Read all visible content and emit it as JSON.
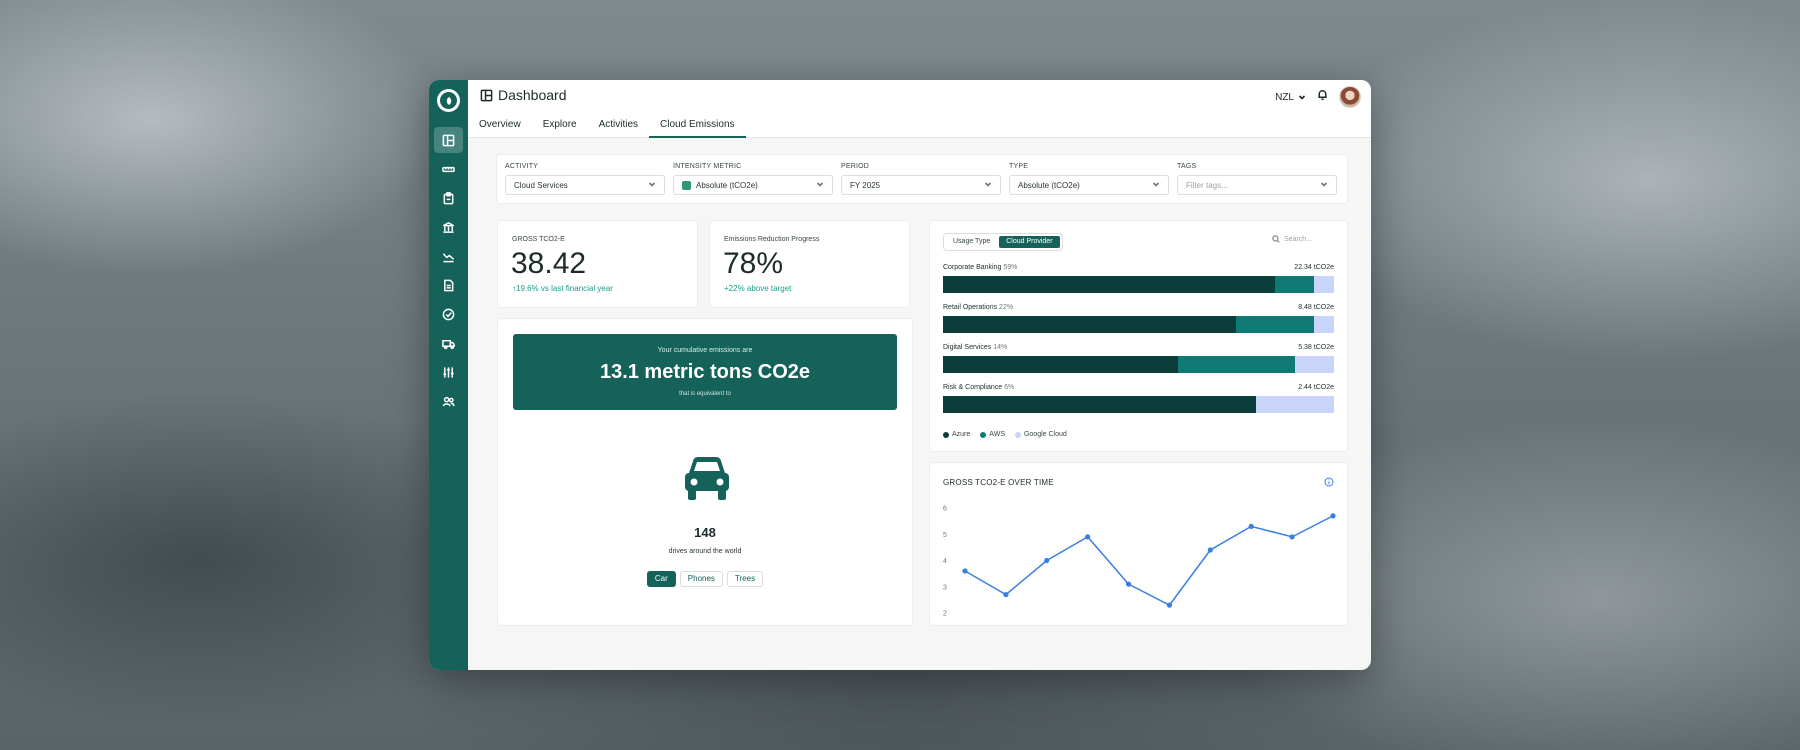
{
  "app": {
    "title": "Dashboard",
    "region": "NZL"
  },
  "sidebar": {
    "items": [
      {
        "icon": "layout-icon",
        "active": true
      },
      {
        "icon": "ruler-icon"
      },
      {
        "icon": "clipboard-icon"
      },
      {
        "icon": "bank-icon"
      },
      {
        "icon": "trend-icon"
      },
      {
        "icon": "document-icon"
      },
      {
        "icon": "check-circle-icon"
      },
      {
        "icon": "truck-icon"
      },
      {
        "icon": "sliders-icon"
      },
      {
        "icon": "users-icon"
      }
    ]
  },
  "tabs": [
    "Overview",
    "Explore",
    "Activities",
    "Cloud Emissions"
  ],
  "active_tab": "Cloud Emissions",
  "filters": [
    {
      "label": "ACTIVITY",
      "value": "Cloud Services"
    },
    {
      "label": "INTENSITY METRIC",
      "value": "Absolute (tCO2e)"
    },
    {
      "label": "PERIOD",
      "value": "FY 2025"
    },
    {
      "label": "TYPE",
      "value": "Absolute (tCO2e)"
    },
    {
      "label": "TAGS",
      "placeholder": "Filter tags..."
    }
  ],
  "stats": {
    "gross": {
      "label": "GROSS TCO2-E",
      "value": "38.42",
      "change": "↑19.6% vs last financial year"
    },
    "progress": {
      "label": "Emissions Reduction Progress",
      "value": "78%",
      "change": "+22% above target"
    }
  },
  "equivalent": {
    "intro": "Your cumulative emissions are",
    "total": "13.1 metric tons CO2e",
    "sub": "that is equivalent to",
    "value": "148",
    "description": "drives around the world",
    "options": [
      "Car",
      "Phones",
      "Trees"
    ],
    "active_option": "Car"
  },
  "breakdown": {
    "toggle": [
      "Usage Type",
      "Cloud Provider"
    ],
    "active_toggle": "Cloud Provider",
    "search_placeholder": "Search...",
    "colors": {
      "Azure": "#0b3d3a",
      "AWS": "#0f7a74",
      "Google Cloud": "#c9d4fb"
    },
    "rows": [
      {
        "name": "Corporate Banking",
        "pct": "59%",
        "total": "22.34 tCO2e",
        "shares": [
          0.85,
          0.1,
          0.05
        ]
      },
      {
        "name": "Retail Operations",
        "pct": "22%",
        "total": "8.48 tCO2e",
        "shares": [
          0.75,
          0.2,
          0.05
        ]
      },
      {
        "name": "Digital Services",
        "pct": "14%",
        "total": "5.38 tCO2e",
        "shares": [
          0.6,
          0.3,
          0.1
        ]
      },
      {
        "name": "Risk & Compliance",
        "pct": "6%",
        "total": "2.44 tCO2e",
        "shares": [
          0.8,
          0.0,
          0.2
        ]
      }
    ],
    "legend": [
      "Azure",
      "AWS",
      "Google Cloud"
    ]
  },
  "chart_data": {
    "type": "line",
    "title": "GROSS TCO2-E OVER TIME",
    "x": [
      1,
      2,
      3,
      4,
      5,
      6,
      7,
      8,
      9,
      10
    ],
    "values": [
      3.6,
      2.7,
      4.0,
      4.9,
      3.1,
      2.3,
      4.4,
      5.3,
      4.9,
      5.7
    ],
    "ylim": [
      2,
      6
    ],
    "yticks": [
      2,
      3,
      4,
      5,
      6
    ],
    "color": "#3b7fe0"
  }
}
